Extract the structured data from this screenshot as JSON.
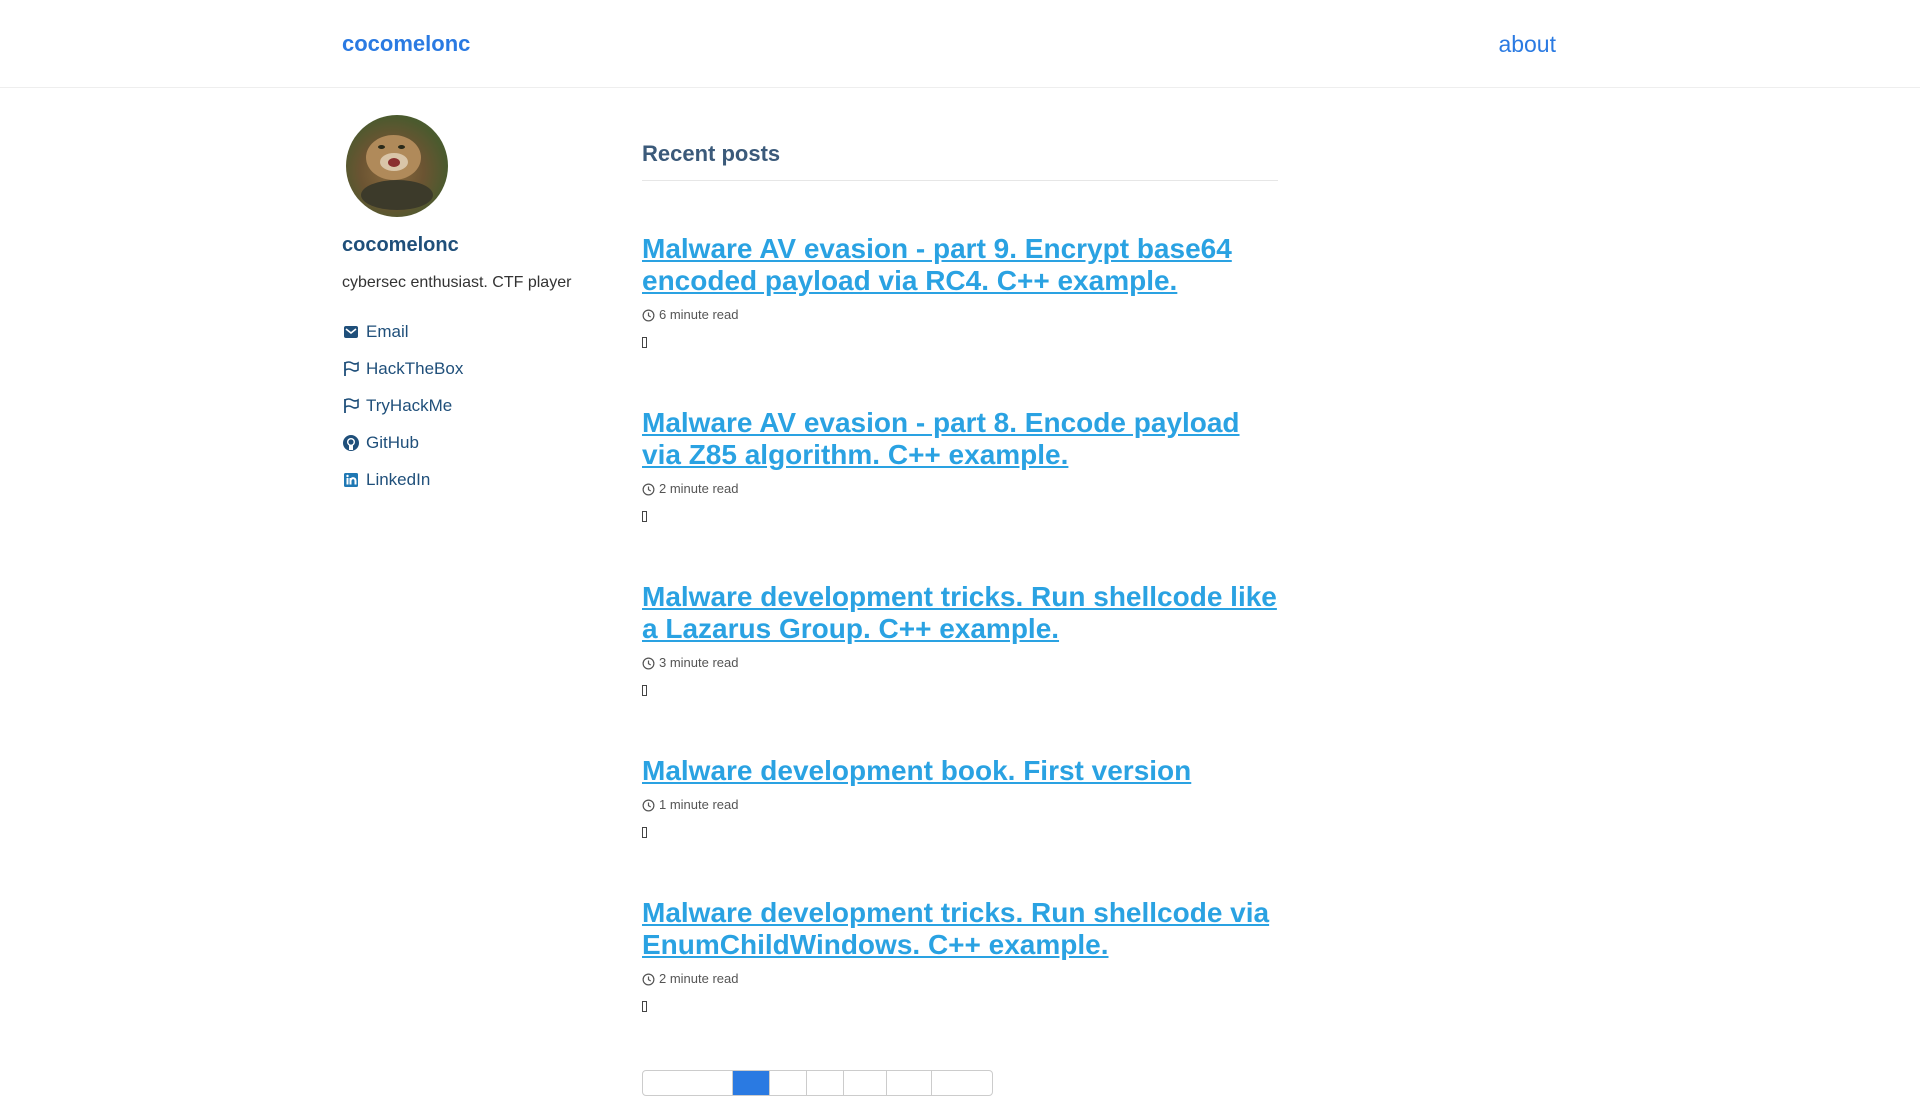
{
  "header": {
    "site_title": "cocomelonc",
    "nav": [
      {
        "label": "about"
      }
    ]
  },
  "sidebar": {
    "author_name": "cocomelonc",
    "bio": "cybersec enthusiast. CTF player",
    "links": [
      {
        "label": "Email",
        "icon": "email-icon"
      },
      {
        "label": "HackTheBox",
        "icon": "flag-icon"
      },
      {
        "label": "TryHackMe",
        "icon": "flag-icon"
      },
      {
        "label": "GitHub",
        "icon": "github-icon"
      },
      {
        "label": "LinkedIn",
        "icon": "linkedin-icon"
      }
    ]
  },
  "main": {
    "section_title": "Recent posts",
    "posts": [
      {
        "title": "Malware AV evasion - part 9. Encrypt base64 encoded payload via RC4. C++ example.",
        "read_time": "6 minute read"
      },
      {
        "title": "Malware AV evasion - part 8. Encode payload via Z85 algorithm. C++ example.",
        "read_time": "2 minute read"
      },
      {
        "title": "Malware development tricks. Run shellcode like a Lazarus Group. C++ example.",
        "read_time": "3 minute read"
      },
      {
        "title": "Malware development book. First version",
        "read_time": "1 minute read"
      },
      {
        "title": "Malware development tricks. Run shellcode via EnumChildWindows. C++ example.",
        "read_time": "2 minute read"
      }
    ]
  },
  "colors": {
    "link": "#2a7ae2",
    "post_title": "#2aa2e2",
    "sidebar_text": "#1f4f7a"
  }
}
